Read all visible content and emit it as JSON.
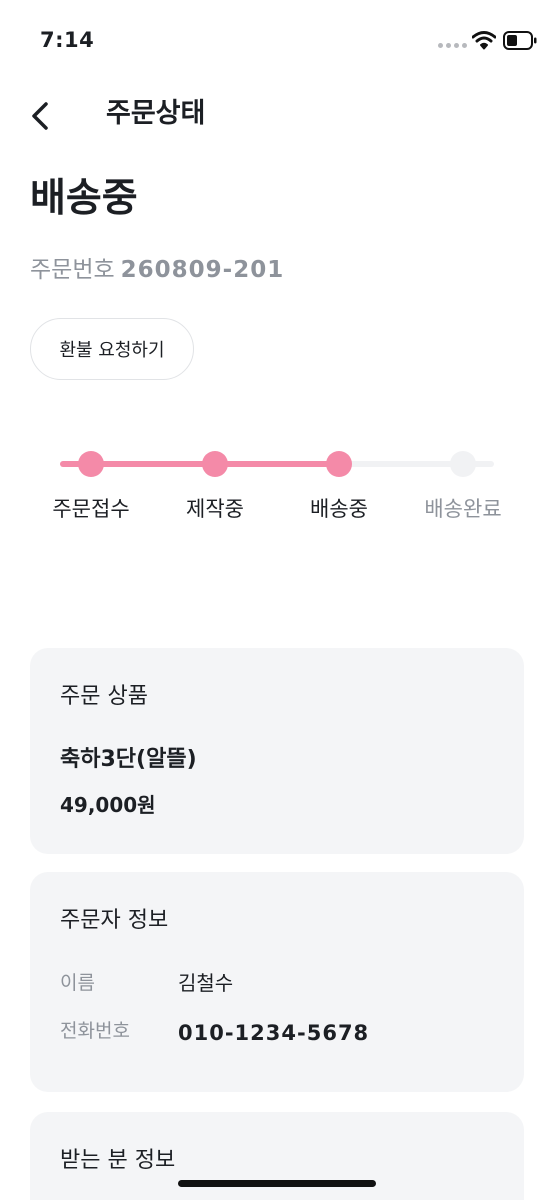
{
  "status_bar": {
    "time": "7:14"
  },
  "header": {
    "title": "주문상태"
  },
  "order": {
    "status": "배송중",
    "number_label": "주문번호",
    "number_value": "260809-201",
    "refund_label": "환불 요청하기"
  },
  "progress": {
    "current_step": 3,
    "total_steps": 4,
    "steps": [
      {
        "label": "주문접수",
        "done": true
      },
      {
        "label": "제작중",
        "done": true
      },
      {
        "label": "배송중",
        "done": true
      },
      {
        "label": "배송완료",
        "done": false
      }
    ],
    "accent_color": "#f48aa8"
  },
  "product_card": {
    "title": "주문 상품",
    "name": "축하3단(알뜰)",
    "price": "49,000원"
  },
  "orderer_card": {
    "title": "주문자 정보",
    "rows": [
      {
        "label": "이름",
        "value": "김철수"
      },
      {
        "label": "전화번호",
        "value": "010-1234-5678"
      }
    ]
  },
  "recipient_card": {
    "title": "받는 분 정보"
  }
}
